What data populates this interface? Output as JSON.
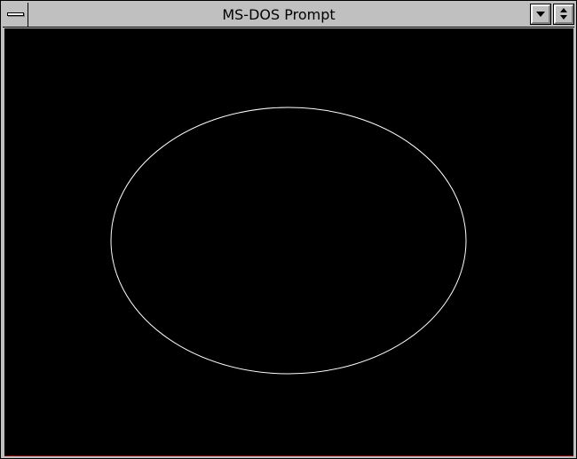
{
  "window": {
    "title": "MS-DOS Prompt",
    "controls": [
      "system-menu",
      "minimize",
      "restore"
    ]
  },
  "screen": {
    "background": "#000000",
    "shape": "ellipse",
    "stroke_color": "#ffffff"
  },
  "colors": {
    "frame": "#c0c0c0",
    "border": "#000000"
  }
}
